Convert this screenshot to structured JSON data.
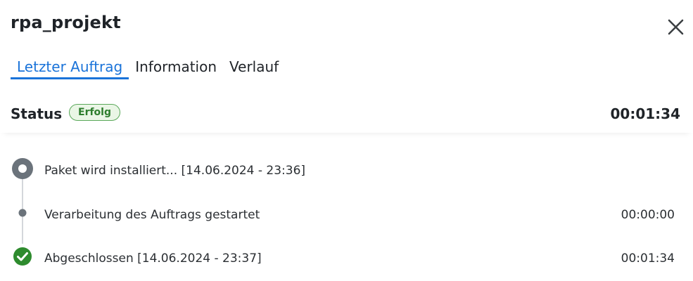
{
  "header": {
    "title": "rpa_projekt",
    "close_icon": "close-icon"
  },
  "tabs": [
    {
      "label": "Letzter Auftrag",
      "active": true
    },
    {
      "label": "Information",
      "active": false
    },
    {
      "label": "Verlauf",
      "active": false
    }
  ],
  "status": {
    "label": "Status",
    "badge": "Erfolg",
    "badge_color": "#2d7d2d",
    "duration": "00:01:34"
  },
  "timeline": [
    {
      "icon": "progress-ring-icon",
      "text": "Paket wird installiert... [14.06.2024 - 23:36]",
      "time": ""
    },
    {
      "icon": "dot-icon",
      "text": "Verarbeitung des Auftrags gestartet",
      "time": "00:00:00"
    },
    {
      "icon": "check-circle-icon",
      "text": "Abgeschlossen [14.06.2024 - 23:37]",
      "time": "00:01:34"
    }
  ],
  "colors": {
    "accent": "#1a73d9",
    "success": "#2e8b2e",
    "neutral_marker": "#6b737b"
  }
}
